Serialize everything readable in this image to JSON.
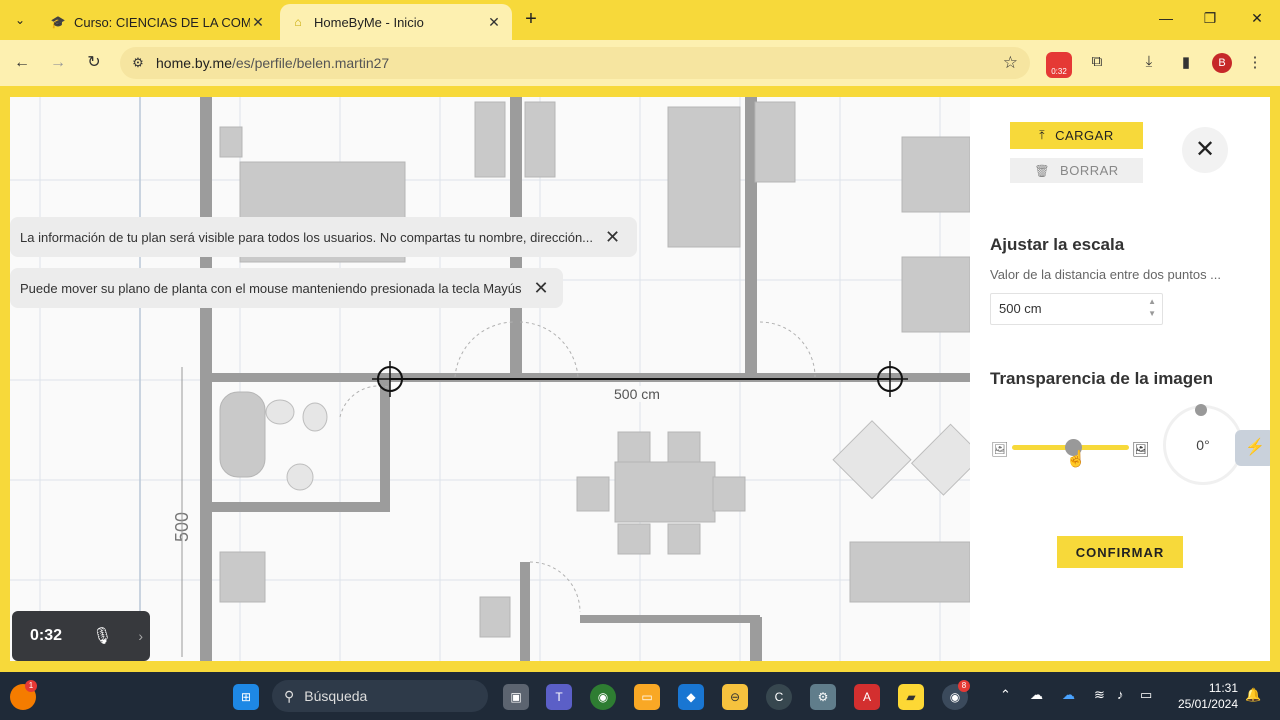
{
  "browser": {
    "tabs": [
      {
        "title": "Curso: CIENCIAS DE LA COMPU",
        "active": false
      },
      {
        "title": "HomeByMe - Inicio",
        "active": true
      }
    ],
    "url_host": "home.by.me",
    "url_path": "/es/perfile/belen.martin27",
    "recording_badge": "0:32",
    "profile_initial": "B"
  },
  "toasts": [
    {
      "text": "La información de tu plan será visible para todos los usuarios. No compartas tu nombre, dirección..."
    },
    {
      "text": "Puede mover su plano de planta con el mouse manteniendo presionada la tecla Mayús"
    }
  ],
  "plan": {
    "scale_line_label": "500 cm",
    "side_dimension": "500"
  },
  "recorder": {
    "time": "0:32"
  },
  "panel": {
    "upload_label": "CARGAR",
    "delete_label": "BORRAR",
    "scale_heading": "Ajustar la escala",
    "scale_desc": "Valor de la distancia entre dos puntos ...",
    "scale_value": "500 cm",
    "transparency_heading": "Transparencia de la imagen",
    "transparency_level": 0.5,
    "rotation": "0°",
    "confirm_label": "CONFIRMAR"
  },
  "taskbar": {
    "search_placeholder": "Búsqueda",
    "time": "11:31",
    "date": "25/01/2024",
    "notification_badge": "1",
    "chrome_badge": "8"
  },
  "colors": {
    "accent_yellow": "#f7d93a",
    "toolbar_cream": "#fdf0b0",
    "taskbar": "#1f2a38"
  }
}
